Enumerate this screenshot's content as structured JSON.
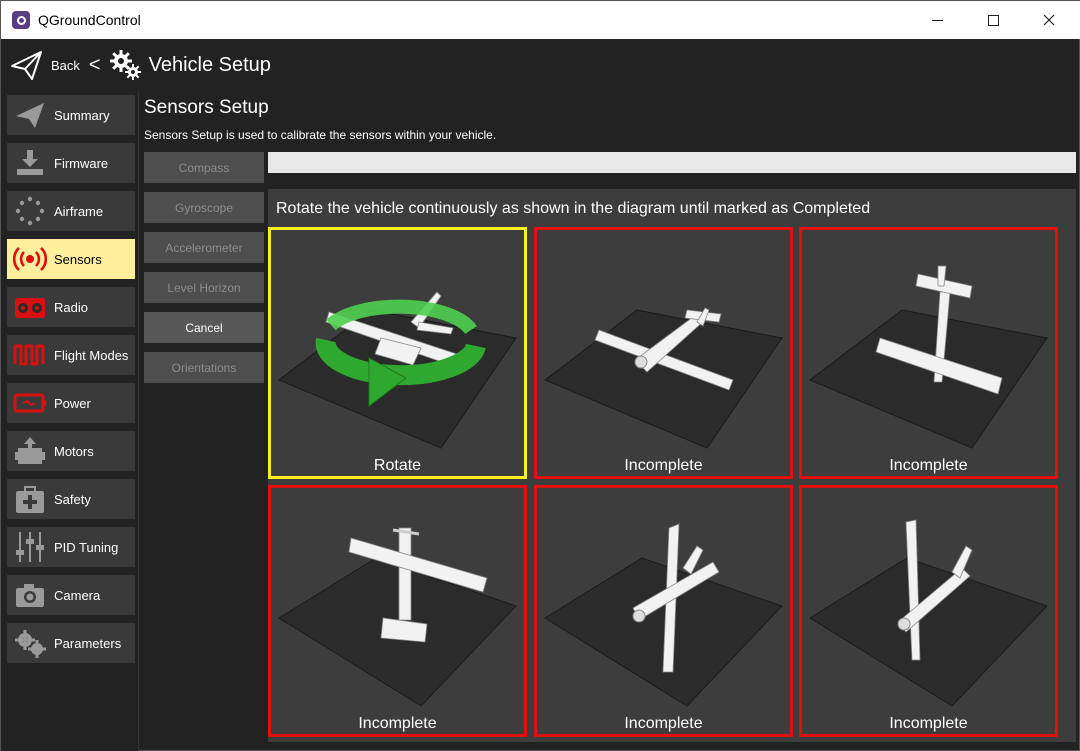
{
  "window": {
    "title": "QGroundControl"
  },
  "toolbar": {
    "back_label": "Back",
    "back_arrow": "<",
    "heading": "Vehicle Setup"
  },
  "sidebar": {
    "items": [
      {
        "label": "Summary",
        "icon": "plane-icon"
      },
      {
        "label": "Firmware",
        "icon": "download-icon"
      },
      {
        "label": "Airframe",
        "icon": "airframe-dots-icon"
      },
      {
        "label": "Sensors",
        "icon": "sensors-icon",
        "active": true
      },
      {
        "label": "Radio",
        "icon": "radio-icon"
      },
      {
        "label": "Flight Modes",
        "icon": "flight-modes-icon"
      },
      {
        "label": "Power",
        "icon": "battery-icon"
      },
      {
        "label": "Motors",
        "icon": "motor-icon"
      },
      {
        "label": "Safety",
        "icon": "first-aid-icon"
      },
      {
        "label": "PID Tuning",
        "icon": "sliders-icon"
      },
      {
        "label": "Camera",
        "icon": "camera-icon"
      },
      {
        "label": "Parameters",
        "icon": "gears-icon"
      }
    ]
  },
  "sensors": {
    "title": "Sensors Setup",
    "description": "Sensors Setup is used to calibrate the sensors within your vehicle.",
    "buttons": [
      {
        "label": "Compass",
        "enabled": false
      },
      {
        "label": "Gyroscope",
        "enabled": false
      },
      {
        "label": "Accelerometer",
        "enabled": false
      },
      {
        "label": "Level Horizon",
        "enabled": false
      },
      {
        "label": "Cancel",
        "enabled": true
      },
      {
        "label": "Orientations",
        "enabled": false
      }
    ],
    "progress": 0,
    "instruction": "Rotate the vehicle continuously as shown in the diagram until marked as Completed",
    "tiles": [
      {
        "label": "Rotate",
        "state": "current"
      },
      {
        "label": "Incomplete",
        "state": "incomplete"
      },
      {
        "label": "Incomplete",
        "state": "incomplete"
      },
      {
        "label": "Incomplete",
        "state": "incomplete"
      },
      {
        "label": "Incomplete",
        "state": "incomplete"
      },
      {
        "label": "Incomplete",
        "state": "incomplete"
      }
    ]
  },
  "colors": {
    "accent": "#ffef9c",
    "current_border": "#ffef1f",
    "incomplete_border": "#e01010",
    "rotate_arrow": "#2fa82f"
  }
}
